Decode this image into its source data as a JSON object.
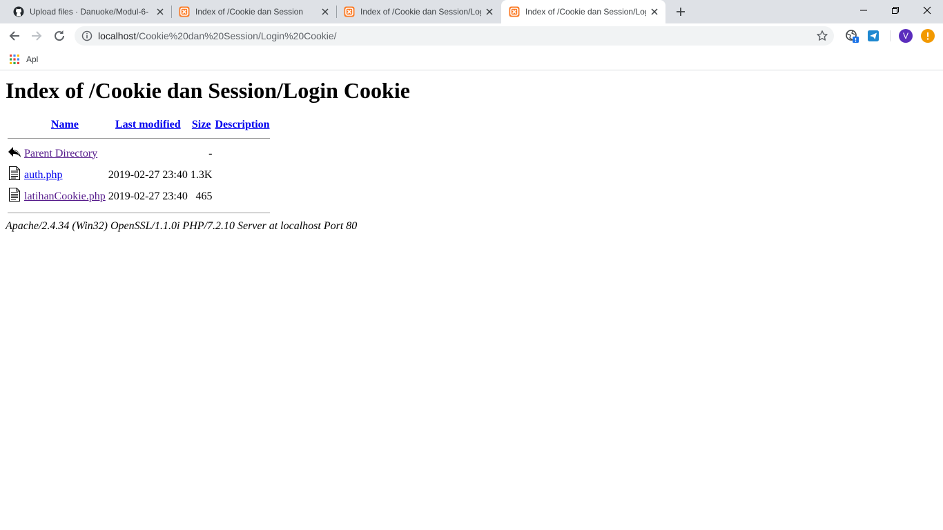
{
  "browser": {
    "tabs": [
      {
        "title": "Upload files · Danuoke/Modul-6-",
        "icon": "github-icon",
        "active": false
      },
      {
        "title": "Index of /Cookie dan Session",
        "icon": "xampp-icon",
        "active": false
      },
      {
        "title": "Index of /Cookie dan Session/Log",
        "icon": "xampp-icon",
        "active": false
      },
      {
        "title": "Index of /Cookie dan Session/Log",
        "icon": "xampp-icon",
        "active": true
      }
    ],
    "address": {
      "host": "localhost",
      "path": "/Cookie%20dan%20Session/Login%20Cookie/"
    },
    "bookmarks": {
      "apps_label": "Apl"
    },
    "profile_initial": "V",
    "colors": {
      "tabstrip": "#dee1e6",
      "omnibox": "#f1f3f4",
      "profile": "#5b2dbd",
      "update_badge": "#f29900",
      "xampp": "#fb7a24"
    }
  },
  "page": {
    "heading": "Index of /Cookie dan Session/Login Cookie",
    "columns": {
      "name": "Name",
      "last_modified": "Last modified",
      "size": "Size",
      "description": "Description"
    },
    "rows": [
      {
        "name": "Parent Directory",
        "modified": "",
        "size": "-",
        "description": "",
        "icon": "back-arrow-icon"
      },
      {
        "name": "auth.php",
        "modified": "2019-02-27 23:40",
        "size": "1.3K",
        "description": "",
        "icon": "text-file-icon"
      },
      {
        "name": "latihanCookie.php",
        "modified": "2019-02-27 23:40",
        "size": "465",
        "description": "",
        "icon": "text-file-icon"
      }
    ],
    "footer": "Apache/2.4.34 (Win32) OpenSSL/1.1.0i PHP/7.2.10 Server at localhost Port 80"
  }
}
